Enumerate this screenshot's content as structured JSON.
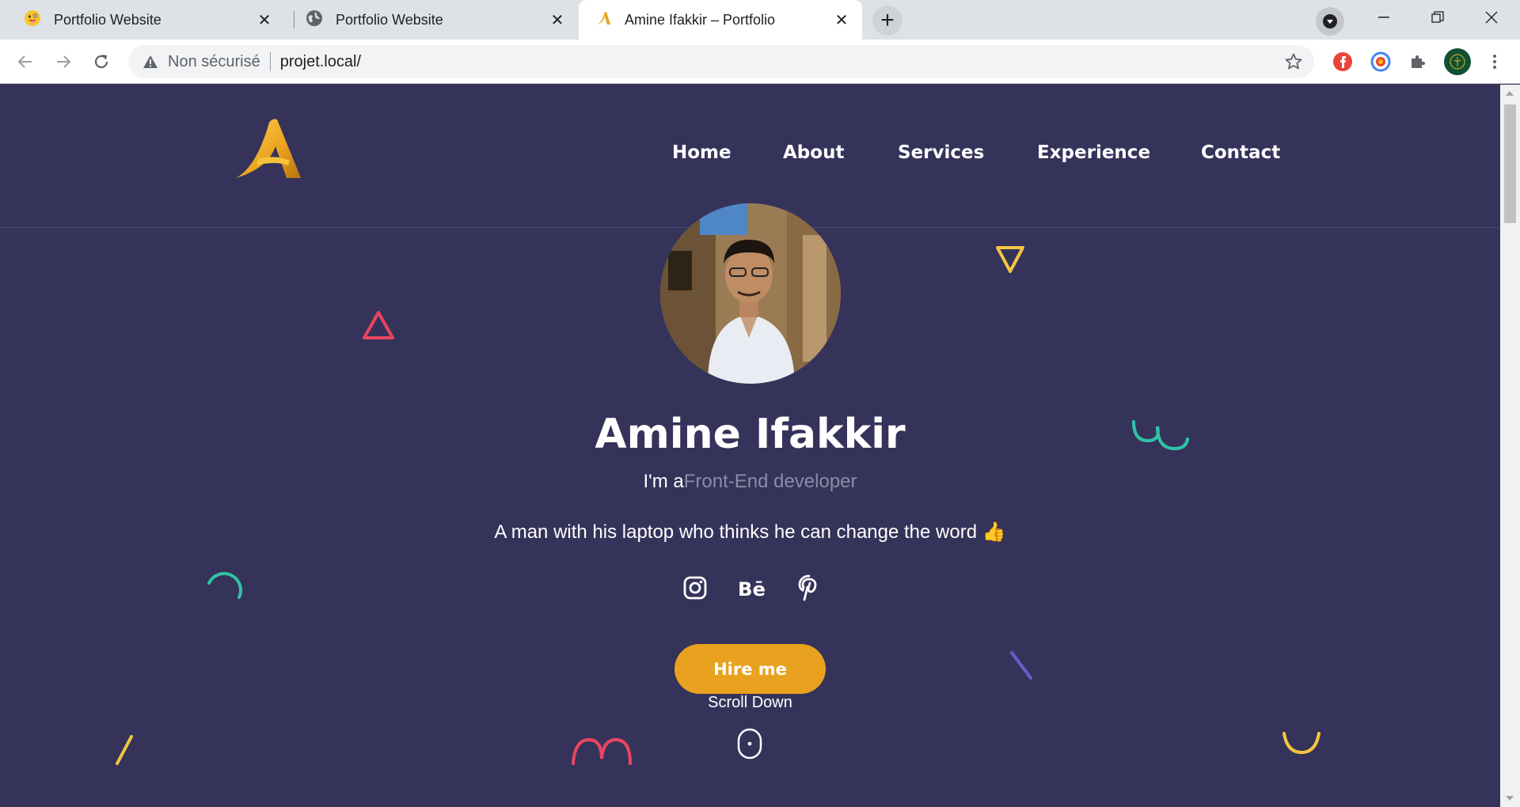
{
  "browser": {
    "tabs": [
      {
        "title": "Portfolio Website",
        "favicon": "emoji-face-icon"
      },
      {
        "title": "Portfolio Website",
        "favicon": "globe-icon"
      },
      {
        "title": "Amine Ifakkir – Portfolio",
        "favicon": "logo-a-icon",
        "active": true
      }
    ],
    "new_tab": "+",
    "security_label": "Non sécurisé",
    "url": "projet.local/"
  },
  "site": {
    "nav": [
      "Home",
      "About",
      "Services",
      "Experience",
      "Contact"
    ],
    "name": "Amine Ifakkir",
    "role_prefix": "I'm a",
    "role_typed": "Front-End developer",
    "tagline": "A man with his laptop who thinks he can change the word 👍",
    "socials": [
      "instagram-icon",
      "behance-icon",
      "pinterest-icon"
    ],
    "hire_label": "Hire me",
    "scroll_label": "Scroll Down"
  },
  "colors": {
    "background": "#35335a",
    "accent": "#e9a21f",
    "typed_text": "#8d8ba6",
    "shape_red": "#e94560",
    "shape_teal": "#2ec4a6",
    "shape_yellow": "#f5c542",
    "shape_purple": "#6a5acd"
  }
}
